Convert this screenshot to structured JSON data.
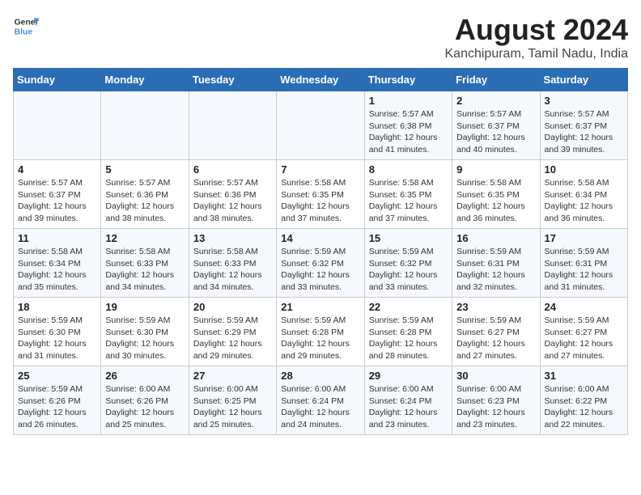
{
  "logo": {
    "line1": "General",
    "line2": "Blue"
  },
  "title": "August 2024",
  "subtitle": "Kanchipuram, Tamil Nadu, India",
  "days_header": [
    "Sunday",
    "Monday",
    "Tuesday",
    "Wednesday",
    "Thursday",
    "Friday",
    "Saturday"
  ],
  "weeks": [
    [
      {
        "num": "",
        "detail": ""
      },
      {
        "num": "",
        "detail": ""
      },
      {
        "num": "",
        "detail": ""
      },
      {
        "num": "",
        "detail": ""
      },
      {
        "num": "1",
        "detail": "Sunrise: 5:57 AM\nSunset: 6:38 PM\nDaylight: 12 hours\nand 41 minutes."
      },
      {
        "num": "2",
        "detail": "Sunrise: 5:57 AM\nSunset: 6:37 PM\nDaylight: 12 hours\nand 40 minutes."
      },
      {
        "num": "3",
        "detail": "Sunrise: 5:57 AM\nSunset: 6:37 PM\nDaylight: 12 hours\nand 39 minutes."
      }
    ],
    [
      {
        "num": "4",
        "detail": "Sunrise: 5:57 AM\nSunset: 6:37 PM\nDaylight: 12 hours\nand 39 minutes."
      },
      {
        "num": "5",
        "detail": "Sunrise: 5:57 AM\nSunset: 6:36 PM\nDaylight: 12 hours\nand 38 minutes."
      },
      {
        "num": "6",
        "detail": "Sunrise: 5:57 AM\nSunset: 6:36 PM\nDaylight: 12 hours\nand 38 minutes."
      },
      {
        "num": "7",
        "detail": "Sunrise: 5:58 AM\nSunset: 6:35 PM\nDaylight: 12 hours\nand 37 minutes."
      },
      {
        "num": "8",
        "detail": "Sunrise: 5:58 AM\nSunset: 6:35 PM\nDaylight: 12 hours\nand 37 minutes."
      },
      {
        "num": "9",
        "detail": "Sunrise: 5:58 AM\nSunset: 6:35 PM\nDaylight: 12 hours\nand 36 minutes."
      },
      {
        "num": "10",
        "detail": "Sunrise: 5:58 AM\nSunset: 6:34 PM\nDaylight: 12 hours\nand 36 minutes."
      }
    ],
    [
      {
        "num": "11",
        "detail": "Sunrise: 5:58 AM\nSunset: 6:34 PM\nDaylight: 12 hours\nand 35 minutes."
      },
      {
        "num": "12",
        "detail": "Sunrise: 5:58 AM\nSunset: 6:33 PM\nDaylight: 12 hours\nand 34 minutes."
      },
      {
        "num": "13",
        "detail": "Sunrise: 5:58 AM\nSunset: 6:33 PM\nDaylight: 12 hours\nand 34 minutes."
      },
      {
        "num": "14",
        "detail": "Sunrise: 5:59 AM\nSunset: 6:32 PM\nDaylight: 12 hours\nand 33 minutes."
      },
      {
        "num": "15",
        "detail": "Sunrise: 5:59 AM\nSunset: 6:32 PM\nDaylight: 12 hours\nand 33 minutes."
      },
      {
        "num": "16",
        "detail": "Sunrise: 5:59 AM\nSunset: 6:31 PM\nDaylight: 12 hours\nand 32 minutes."
      },
      {
        "num": "17",
        "detail": "Sunrise: 5:59 AM\nSunset: 6:31 PM\nDaylight: 12 hours\nand 31 minutes."
      }
    ],
    [
      {
        "num": "18",
        "detail": "Sunrise: 5:59 AM\nSunset: 6:30 PM\nDaylight: 12 hours\nand 31 minutes."
      },
      {
        "num": "19",
        "detail": "Sunrise: 5:59 AM\nSunset: 6:30 PM\nDaylight: 12 hours\nand 30 minutes."
      },
      {
        "num": "20",
        "detail": "Sunrise: 5:59 AM\nSunset: 6:29 PM\nDaylight: 12 hours\nand 29 minutes."
      },
      {
        "num": "21",
        "detail": "Sunrise: 5:59 AM\nSunset: 6:28 PM\nDaylight: 12 hours\nand 29 minutes."
      },
      {
        "num": "22",
        "detail": "Sunrise: 5:59 AM\nSunset: 6:28 PM\nDaylight: 12 hours\nand 28 minutes."
      },
      {
        "num": "23",
        "detail": "Sunrise: 5:59 AM\nSunset: 6:27 PM\nDaylight: 12 hours\nand 27 minutes."
      },
      {
        "num": "24",
        "detail": "Sunrise: 5:59 AM\nSunset: 6:27 PM\nDaylight: 12 hours\nand 27 minutes."
      }
    ],
    [
      {
        "num": "25",
        "detail": "Sunrise: 5:59 AM\nSunset: 6:26 PM\nDaylight: 12 hours\nand 26 minutes."
      },
      {
        "num": "26",
        "detail": "Sunrise: 6:00 AM\nSunset: 6:26 PM\nDaylight: 12 hours\nand 25 minutes."
      },
      {
        "num": "27",
        "detail": "Sunrise: 6:00 AM\nSunset: 6:25 PM\nDaylight: 12 hours\nand 25 minutes."
      },
      {
        "num": "28",
        "detail": "Sunrise: 6:00 AM\nSunset: 6:24 PM\nDaylight: 12 hours\nand 24 minutes."
      },
      {
        "num": "29",
        "detail": "Sunrise: 6:00 AM\nSunset: 6:24 PM\nDaylight: 12 hours\nand 23 minutes."
      },
      {
        "num": "30",
        "detail": "Sunrise: 6:00 AM\nSunset: 6:23 PM\nDaylight: 12 hours\nand 23 minutes."
      },
      {
        "num": "31",
        "detail": "Sunrise: 6:00 AM\nSunset: 6:22 PM\nDaylight: 12 hours\nand 22 minutes."
      }
    ]
  ]
}
